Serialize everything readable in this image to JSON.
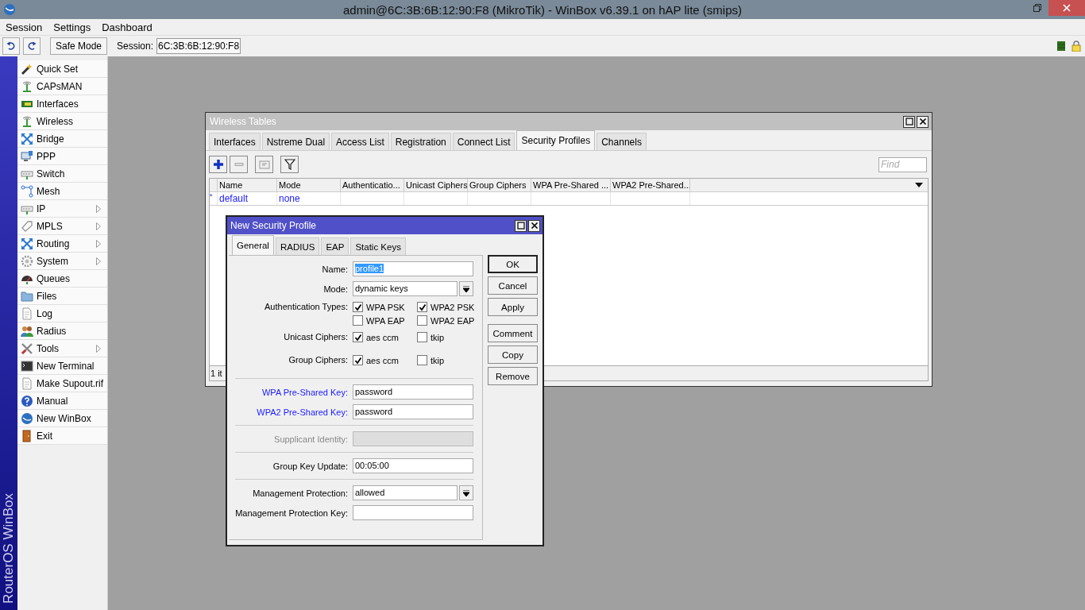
{
  "window": {
    "title": "admin@6C:3B:6B:12:90:F8 (MikroTik) - WinBox v6.39.1 on hAP lite (smips)"
  },
  "menu": [
    "Session",
    "Settings",
    "Dashboard"
  ],
  "toolbar": {
    "safe_mode": "Safe Mode",
    "session_label": "Session:",
    "session_value": "6C:3B:6B:12:90:F8"
  },
  "sidebar": {
    "brand": "RouterOS WinBox",
    "items": [
      {
        "label": "Quick Set",
        "submenu": false
      },
      {
        "label": "CAPsMAN",
        "submenu": false
      },
      {
        "label": "Interfaces",
        "submenu": false
      },
      {
        "label": "Wireless",
        "submenu": false
      },
      {
        "label": "Bridge",
        "submenu": false
      },
      {
        "label": "PPP",
        "submenu": false
      },
      {
        "label": "Switch",
        "submenu": false
      },
      {
        "label": "Mesh",
        "submenu": false
      },
      {
        "label": "IP",
        "submenu": true
      },
      {
        "label": "MPLS",
        "submenu": true
      },
      {
        "label": "Routing",
        "submenu": true
      },
      {
        "label": "System",
        "submenu": true
      },
      {
        "label": "Queues",
        "submenu": false
      },
      {
        "label": "Files",
        "submenu": false
      },
      {
        "label": "Log",
        "submenu": false
      },
      {
        "label": "Radius",
        "submenu": false
      },
      {
        "label": "Tools",
        "submenu": true
      },
      {
        "label": "New Terminal",
        "submenu": false
      },
      {
        "label": "Make Supout.rif",
        "submenu": false
      },
      {
        "label": "Manual",
        "submenu": false
      },
      {
        "label": "New WinBox",
        "submenu": false
      },
      {
        "label": "Exit",
        "submenu": false
      }
    ]
  },
  "wireless_tables": {
    "title": "Wireless Tables",
    "tabs": [
      {
        "label": "Interfaces",
        "selected": false
      },
      {
        "label": "Nstreme Dual",
        "selected": false
      },
      {
        "label": "Access List",
        "selected": false
      },
      {
        "label": "Registration",
        "selected": false
      },
      {
        "label": "Connect List",
        "selected": false
      },
      {
        "label": "Security Profiles",
        "selected": true
      },
      {
        "label": "Channels",
        "selected": false
      }
    ],
    "find_placeholder": "Find",
    "columns": [
      "Name",
      "Mode",
      "Authenticatio...",
      "Unicast Ciphers",
      "Group Ciphers",
      "WPA Pre-Shared ...",
      "WPA2 Pre-Shared..."
    ],
    "rows": [
      {
        "marker": "*",
        "cells": [
          "default",
          "none",
          "",
          "",
          "",
          "",
          ""
        ]
      }
    ],
    "status": "1 it"
  },
  "dialog": {
    "title": "New Security Profile",
    "tabs": [
      {
        "label": "General",
        "selected": true
      },
      {
        "label": "RADIUS",
        "selected": false
      },
      {
        "label": "EAP",
        "selected": false
      },
      {
        "label": "Static Keys",
        "selected": false
      }
    ],
    "fields": [
      {
        "kind": "text",
        "label": "Name:",
        "value": "profile1",
        "value_selected": true,
        "accent": false,
        "disabled": false
      },
      {
        "kind": "select",
        "label": "Mode:",
        "value": "dynamic keys"
      },
      {
        "kind": "checks",
        "label": "Authentication Types:",
        "options": [
          {
            "label": "WPA PSK",
            "checked": true
          },
          {
            "label": "WPA2 PSK",
            "checked": true
          },
          {
            "label": "WPA EAP",
            "checked": false
          },
          {
            "label": "WPA2 EAP",
            "checked": false
          }
        ]
      },
      {
        "kind": "checks",
        "label": "Unicast Ciphers:",
        "options": [
          {
            "label": "aes ccm",
            "checked": true
          },
          {
            "label": "tkip",
            "checked": false
          }
        ]
      },
      {
        "kind": "checks",
        "label": "Group Ciphers:",
        "options": [
          {
            "label": "aes ccm",
            "checked": true
          },
          {
            "label": "tkip",
            "checked": false
          }
        ]
      },
      {
        "kind": "divider"
      },
      {
        "kind": "text",
        "label": "WPA Pre-Shared Key:",
        "value": "password",
        "value_selected": false,
        "accent": true,
        "disabled": false
      },
      {
        "kind": "text",
        "label": "WPA2 Pre-Shared Key:",
        "value": "password",
        "value_selected": false,
        "accent": true,
        "disabled": false
      },
      {
        "kind": "divider"
      },
      {
        "kind": "text",
        "label": "Supplicant Identity:",
        "accent": false,
        "disabled": true
      },
      {
        "kind": "divider"
      },
      {
        "kind": "text",
        "label": "Group Key Update:",
        "value": "00:05:00",
        "value_selected": false,
        "accent": false,
        "disabled": false
      },
      {
        "kind": "divider"
      },
      {
        "kind": "select",
        "label": "Management Protection:",
        "value": "allowed"
      },
      {
        "kind": "text",
        "label": "Management Protection Key:",
        "accent": false,
        "disabled": false
      }
    ],
    "buttons": [
      {
        "label": "OK",
        "default": true
      },
      {
        "label": "Cancel",
        "default": false
      },
      {
        "label": "Apply",
        "default": false
      }
    ],
    "more_buttons": [
      {
        "label": "Comment"
      },
      {
        "label": "Copy"
      },
      {
        "label": "Remove"
      }
    ]
  }
}
